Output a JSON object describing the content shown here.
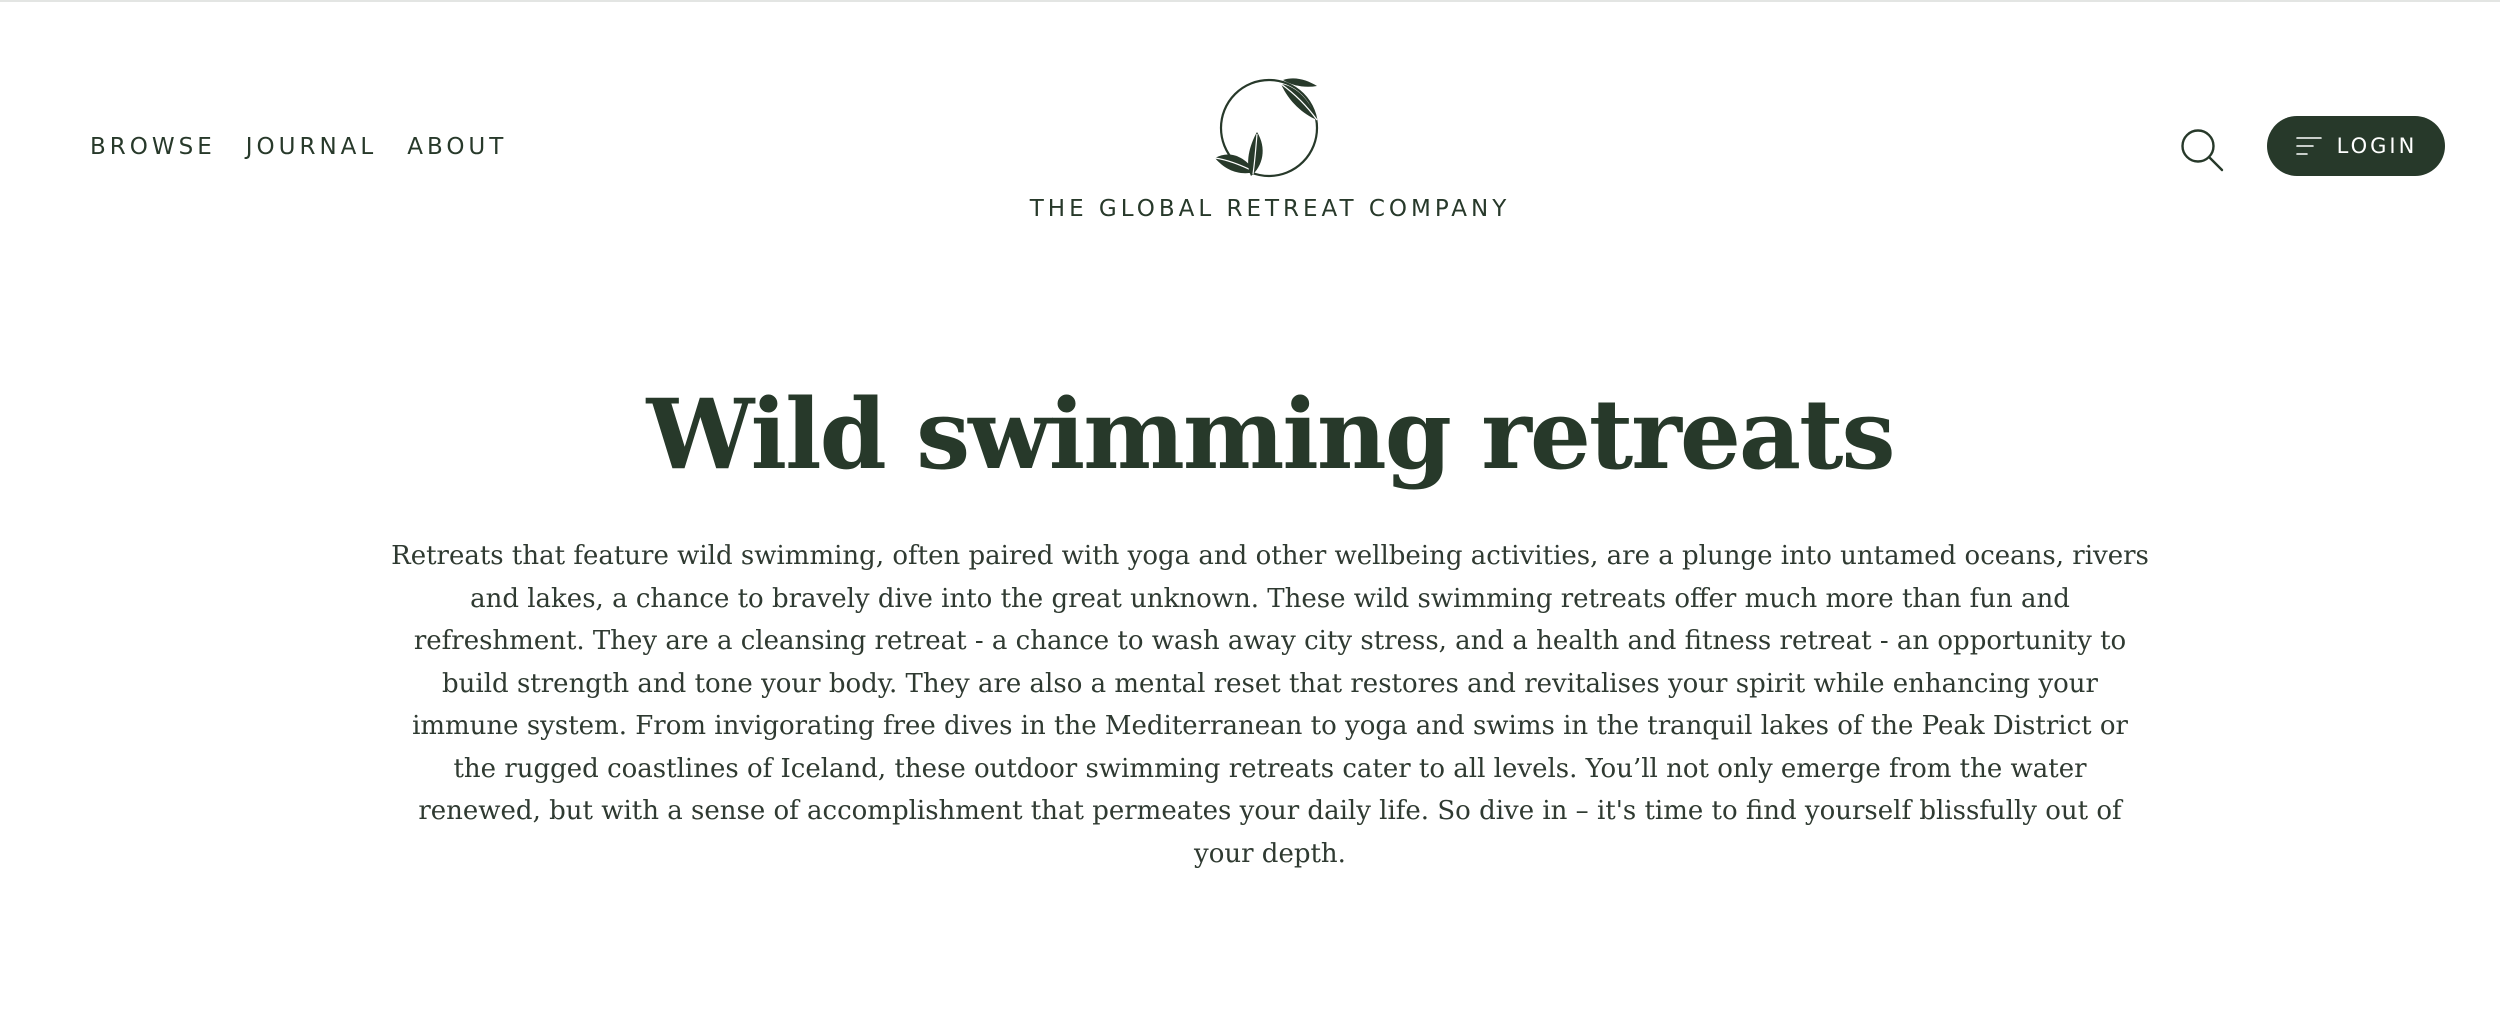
{
  "colors": {
    "brand_green": "#27392a",
    "background": "#ffffff",
    "button_text": "#ffffff"
  },
  "header": {
    "nav": [
      {
        "label": "BROWSE"
      },
      {
        "label": "JOURNAL"
      },
      {
        "label": "ABOUT"
      }
    ],
    "brand": {
      "name": "THE GLOBAL RETREAT COMPANY",
      "logo_icon": "leaf-circle-logo-icon"
    },
    "search_icon": "search-icon",
    "login": {
      "label": "LOGIN",
      "icon": "menu-lines-icon"
    }
  },
  "main": {
    "title": "Wild swimming retreats",
    "intro": "Retreats that feature wild swimming, often paired with yoga and other wellbeing activities, are a plunge into untamed oceans, rivers and lakes, a chance to bravely dive into the great unknown. These wild swimming retreats offer much more than fun and refreshment. They are a cleansing retreat - a chance to wash away city stress, and a health and fitness retreat - an opportunity to build strength and tone your body. They are also a mental reset that restores and revitalises your spirit while enhancing your immune system. From invigorating free dives in the Mediterranean to yoga and swims in the tranquil lakes of the Peak District or the rugged coastlines of Iceland, these outdoor swimming retreats cater to all levels. You’ll not only emerge from the water renewed, but with a sense of accomplishment that permeates your daily life. So dive in – it's time to find yourself blissfully out of your depth."
  }
}
